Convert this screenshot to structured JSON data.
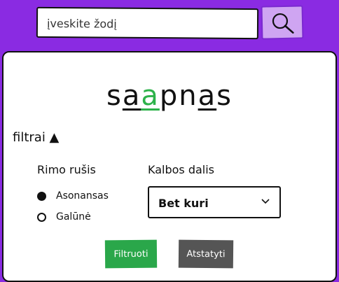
{
  "search": {
    "placeholder": "įveskite žodį",
    "button_icon": "search-icon"
  },
  "word": {
    "letters": [
      "s",
      "a",
      "a",
      "p",
      "n",
      "a",
      "s"
    ],
    "highlight_color": "#2db24a"
  },
  "filters": {
    "toggle_label": "filtrai ▲",
    "rhyme_type": {
      "label": "Rimo rušis",
      "options": [
        {
          "label": "Asonansas",
          "checked": true
        },
        {
          "label": "Galūnė",
          "checked": false
        }
      ]
    },
    "part_of_speech": {
      "label": "Kalbos dalis",
      "selected": "Bet kuri"
    },
    "filter_button": "Filtruoti",
    "reset_button": "Atstatyti"
  },
  "colors": {
    "header": "#8a2be2",
    "search_button": "#cfa5f2",
    "primary": "#2aa74a",
    "secondary": "#555555"
  }
}
